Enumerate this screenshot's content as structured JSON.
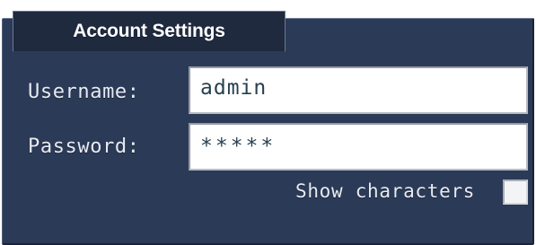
{
  "tab": {
    "title": "Account Settings"
  },
  "username": {
    "label": "Username:",
    "value": "admin"
  },
  "password": {
    "label": "Password:",
    "value": "*****"
  },
  "show_characters": {
    "label": "Show characters",
    "checked": false
  },
  "colors": {
    "panel_background": "#2b3a57",
    "tab_background": "#1f2a3f",
    "label_text": "#e7ebf2",
    "field_text": "#274050"
  }
}
